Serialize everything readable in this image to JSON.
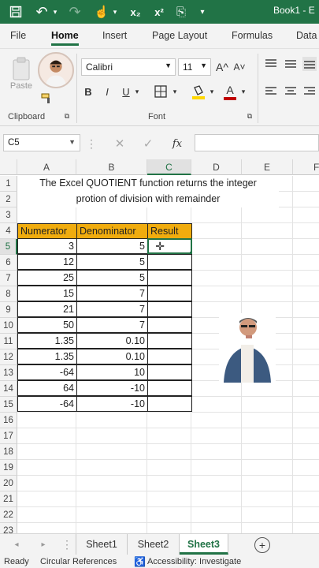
{
  "titlebar": {
    "book_title": "Book1 - E"
  },
  "quick_access": {
    "save_icon": "💾",
    "undo_icon": "↶",
    "redo_icon": "↷",
    "touch_icon": "☝",
    "subscript": "x₂",
    "superscript": "x²",
    "format_icon": "⎘",
    "more_icon": "▾"
  },
  "tabs": [
    "File",
    "Home",
    "Insert",
    "Page Layout",
    "Formulas",
    "Data"
  ],
  "ribbon": {
    "paste_label": "Paste",
    "clipboard_label": "Clipboard",
    "font_label": "Font",
    "font_name": "Calibri",
    "font_size": "11",
    "grow_font": "A^",
    "shrink_font": "A˅",
    "bold": "B",
    "italic": "I",
    "underline": "U",
    "font_color_letter": "A"
  },
  "formula_bar": {
    "name_box": "C5",
    "fx": "fx",
    "cancel": "✕",
    "enter": "✓",
    "formula": ""
  },
  "columns": [
    "A",
    "B",
    "C",
    "D",
    "E",
    "F"
  ],
  "rows": [
    "1",
    "2",
    "3",
    "4",
    "5",
    "6",
    "7",
    "8",
    "9",
    "10",
    "11",
    "12",
    "13",
    "14",
    "15",
    "16",
    "17",
    "18",
    "19",
    "20",
    "21",
    "22",
    "23"
  ],
  "sheet": {
    "title_line1": "The Excel  QUOTIENT function returns the  integer",
    "title_line2": "protion of division with remainder",
    "headers": [
      "Numerator",
      "Denominator",
      "Result"
    ],
    "data": [
      {
        "num": "3",
        "den": "5",
        "res": ""
      },
      {
        "num": "12",
        "den": "5",
        "res": ""
      },
      {
        "num": "25",
        "den": "5",
        "res": ""
      },
      {
        "num": "15",
        "den": "7",
        "res": ""
      },
      {
        "num": "21",
        "den": "7",
        "res": ""
      },
      {
        "num": "50",
        "den": "7",
        "res": ""
      },
      {
        "num": "1.35",
        "den": "0.10",
        "res": ""
      },
      {
        "num": "1.35",
        "den": "0.10",
        "res": ""
      },
      {
        "num": "-64",
        "den": "10",
        "res": ""
      },
      {
        "num": "64",
        "den": "-10",
        "res": ""
      },
      {
        "num": "-64",
        "den": "-10",
        "res": ""
      }
    ]
  },
  "sheet_tabs": [
    "Sheet1",
    "Sheet2",
    "Sheet3"
  ],
  "active_sheet": "Sheet3",
  "status": {
    "ready": "Ready",
    "circular": "Circular References",
    "accessibility": "Accessibility: Investigate"
  },
  "colors": {
    "excel_green": "#217346",
    "header_fill": "#f0ac0e",
    "font_highlight": "#ffd700",
    "font_color": "#c00000"
  }
}
